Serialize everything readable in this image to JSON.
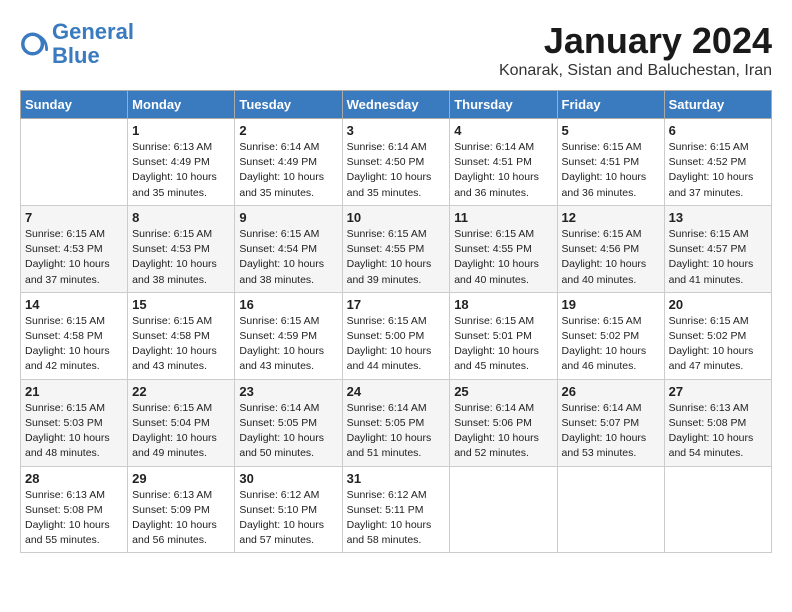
{
  "logo": {
    "line1": "General",
    "line2": "Blue"
  },
  "title": "January 2024",
  "subtitle": "Konarak, Sistan and Baluchestan, Iran",
  "days_of_week": [
    "Sunday",
    "Monday",
    "Tuesday",
    "Wednesday",
    "Thursday",
    "Friday",
    "Saturday"
  ],
  "weeks": [
    [
      {
        "day": "",
        "info": ""
      },
      {
        "day": "1",
        "info": "Sunrise: 6:13 AM\nSunset: 4:49 PM\nDaylight: 10 hours\nand 35 minutes."
      },
      {
        "day": "2",
        "info": "Sunrise: 6:14 AM\nSunset: 4:49 PM\nDaylight: 10 hours\nand 35 minutes."
      },
      {
        "day": "3",
        "info": "Sunrise: 6:14 AM\nSunset: 4:50 PM\nDaylight: 10 hours\nand 35 minutes."
      },
      {
        "day": "4",
        "info": "Sunrise: 6:14 AM\nSunset: 4:51 PM\nDaylight: 10 hours\nand 36 minutes."
      },
      {
        "day": "5",
        "info": "Sunrise: 6:15 AM\nSunset: 4:51 PM\nDaylight: 10 hours\nand 36 minutes."
      },
      {
        "day": "6",
        "info": "Sunrise: 6:15 AM\nSunset: 4:52 PM\nDaylight: 10 hours\nand 37 minutes."
      }
    ],
    [
      {
        "day": "7",
        "info": "Sunrise: 6:15 AM\nSunset: 4:53 PM\nDaylight: 10 hours\nand 37 minutes."
      },
      {
        "day": "8",
        "info": "Sunrise: 6:15 AM\nSunset: 4:53 PM\nDaylight: 10 hours\nand 38 minutes."
      },
      {
        "day": "9",
        "info": "Sunrise: 6:15 AM\nSunset: 4:54 PM\nDaylight: 10 hours\nand 38 minutes."
      },
      {
        "day": "10",
        "info": "Sunrise: 6:15 AM\nSunset: 4:55 PM\nDaylight: 10 hours\nand 39 minutes."
      },
      {
        "day": "11",
        "info": "Sunrise: 6:15 AM\nSunset: 4:55 PM\nDaylight: 10 hours\nand 40 minutes."
      },
      {
        "day": "12",
        "info": "Sunrise: 6:15 AM\nSunset: 4:56 PM\nDaylight: 10 hours\nand 40 minutes."
      },
      {
        "day": "13",
        "info": "Sunrise: 6:15 AM\nSunset: 4:57 PM\nDaylight: 10 hours\nand 41 minutes."
      }
    ],
    [
      {
        "day": "14",
        "info": "Sunrise: 6:15 AM\nSunset: 4:58 PM\nDaylight: 10 hours\nand 42 minutes."
      },
      {
        "day": "15",
        "info": "Sunrise: 6:15 AM\nSunset: 4:58 PM\nDaylight: 10 hours\nand 43 minutes."
      },
      {
        "day": "16",
        "info": "Sunrise: 6:15 AM\nSunset: 4:59 PM\nDaylight: 10 hours\nand 43 minutes."
      },
      {
        "day": "17",
        "info": "Sunrise: 6:15 AM\nSunset: 5:00 PM\nDaylight: 10 hours\nand 44 minutes."
      },
      {
        "day": "18",
        "info": "Sunrise: 6:15 AM\nSunset: 5:01 PM\nDaylight: 10 hours\nand 45 minutes."
      },
      {
        "day": "19",
        "info": "Sunrise: 6:15 AM\nSunset: 5:02 PM\nDaylight: 10 hours\nand 46 minutes."
      },
      {
        "day": "20",
        "info": "Sunrise: 6:15 AM\nSunset: 5:02 PM\nDaylight: 10 hours\nand 47 minutes."
      }
    ],
    [
      {
        "day": "21",
        "info": "Sunrise: 6:15 AM\nSunset: 5:03 PM\nDaylight: 10 hours\nand 48 minutes."
      },
      {
        "day": "22",
        "info": "Sunrise: 6:15 AM\nSunset: 5:04 PM\nDaylight: 10 hours\nand 49 minutes."
      },
      {
        "day": "23",
        "info": "Sunrise: 6:14 AM\nSunset: 5:05 PM\nDaylight: 10 hours\nand 50 minutes."
      },
      {
        "day": "24",
        "info": "Sunrise: 6:14 AM\nSunset: 5:05 PM\nDaylight: 10 hours\nand 51 minutes."
      },
      {
        "day": "25",
        "info": "Sunrise: 6:14 AM\nSunset: 5:06 PM\nDaylight: 10 hours\nand 52 minutes."
      },
      {
        "day": "26",
        "info": "Sunrise: 6:14 AM\nSunset: 5:07 PM\nDaylight: 10 hours\nand 53 minutes."
      },
      {
        "day": "27",
        "info": "Sunrise: 6:13 AM\nSunset: 5:08 PM\nDaylight: 10 hours\nand 54 minutes."
      }
    ],
    [
      {
        "day": "28",
        "info": "Sunrise: 6:13 AM\nSunset: 5:08 PM\nDaylight: 10 hours\nand 55 minutes."
      },
      {
        "day": "29",
        "info": "Sunrise: 6:13 AM\nSunset: 5:09 PM\nDaylight: 10 hours\nand 56 minutes."
      },
      {
        "day": "30",
        "info": "Sunrise: 6:12 AM\nSunset: 5:10 PM\nDaylight: 10 hours\nand 57 minutes."
      },
      {
        "day": "31",
        "info": "Sunrise: 6:12 AM\nSunset: 5:11 PM\nDaylight: 10 hours\nand 58 minutes."
      },
      {
        "day": "",
        "info": ""
      },
      {
        "day": "",
        "info": ""
      },
      {
        "day": "",
        "info": ""
      }
    ]
  ]
}
